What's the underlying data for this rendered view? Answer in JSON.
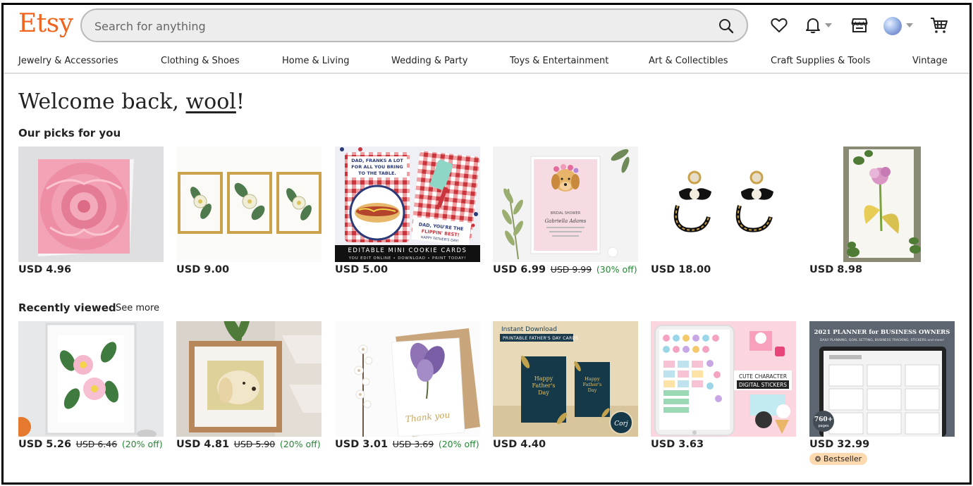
{
  "header": {
    "logo": "Etsy",
    "search_placeholder": "Search for anything"
  },
  "categories": [
    "Jewelry & Accessories",
    "Clothing & Shoes",
    "Home & Living",
    "Wedding & Party",
    "Toys & Entertainment",
    "Art & Collectibles",
    "Craft Supplies & Tools",
    "Vintage"
  ],
  "welcome": {
    "prefix": "Welcome back, ",
    "name": "wool",
    "suffix": "!"
  },
  "picks": {
    "title": "Our picks for you",
    "items": [
      {
        "price": "USD 4.96",
        "image": "pink-camellia-card"
      },
      {
        "price": "USD 9.00",
        "image": "botanical-prints-set"
      },
      {
        "price": "USD 5.00",
        "image": "fathers-day-cookie-cards",
        "image_text": {
          "card_left": "DAD, FRANKS A LOT FOR ALL YOU BRING TO THE TABLE.",
          "card_right": "DAD, YOU'RE THE FLIPPIN' BEST! HAPPY FATHER'S DAY!",
          "banner": "EDITABLE MINI COOKIE CARDS",
          "banner_sub": "YOU EDIT ONLINE • DOWNLOAD • PRINT TODAY!"
        }
      },
      {
        "price": "USD 6.99",
        "original_price": "USD 9.99",
        "discount": "(30% off)",
        "image": "dog-bridal-shower-invite",
        "image_text": {
          "line1": "BRIDAL SHOWER",
          "line2": "Gabriella Adams"
        }
      },
      {
        "price": "USD 18.00",
        "image": "pearl-bow-earrings"
      },
      {
        "price": "USD 8.98",
        "image": "watercolor-flower-painting"
      }
    ]
  },
  "recent": {
    "title": "Recently viewed",
    "see_more": "See more",
    "items": [
      {
        "price": "USD 5.26",
        "original_price": "USD 6.46",
        "discount": "(20% off)",
        "image": "framed-camellia-print"
      },
      {
        "price": "USD 4.81",
        "original_price": "USD 5.90",
        "discount": "(20% off)",
        "image": "framed-dog-print"
      },
      {
        "price": "USD 3.01",
        "original_price": "USD 3.69",
        "discount": "(20% off)",
        "image": "purple-flower-thank-you-card",
        "image_text": {
          "script": "Thank you"
        }
      },
      {
        "price": "USD 4.40",
        "image": "printable-fathers-day-cards",
        "image_text": {
          "top": "Instant Download",
          "ribbon": "PRINTABLE FATHER'S DAY CARDS",
          "card1": "Happy Father's Day",
          "card2": "Happy Father's Day",
          "logo": "Corj"
        }
      },
      {
        "price": "USD 3.63",
        "image": "character-digital-stickers",
        "image_text": {
          "label1": "CUTE CHARACTER",
          "label2": "DIGITAL STICKERS"
        }
      },
      {
        "price": "USD 32.99",
        "badge": "Bestseller",
        "image": "business-planner-2021",
        "image_text": {
          "title": "2021 PLANNER for BUSINESS OWNERS",
          "subtitle": "DAILY PLANNING, GOAL SETTING, BUSINESS TRACKING, STICKERS and more!",
          "circle": "760+ pages"
        }
      }
    ]
  },
  "colors": {
    "brand": "#f1641e",
    "discount": "#258635",
    "badge_bg": "#fdd9b0"
  }
}
